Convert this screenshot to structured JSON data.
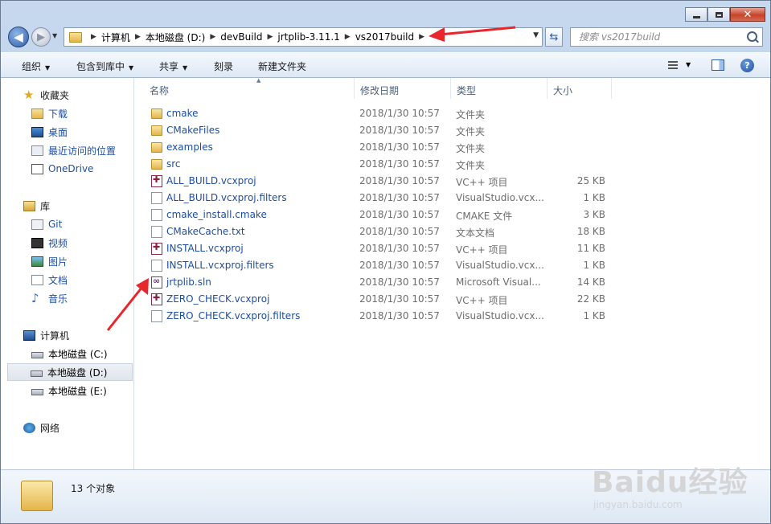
{
  "window": {
    "caption": {
      "minimize": "─",
      "maximize": "□",
      "close": "✕"
    }
  },
  "nav": {
    "breadcrumb": [
      "计算机",
      "本地磁盘 (D:)",
      "devBuild",
      "jrtplib-3.11.1",
      "vs2017build"
    ],
    "search_placeholder": "搜索 vs2017build"
  },
  "toolbar": {
    "organize": "组织",
    "include_in_library": "包含到库中",
    "share": "共享",
    "burn": "刻录",
    "new_folder": "新建文件夹"
  },
  "sidebar": {
    "favorites": {
      "label": "收藏夹",
      "items": [
        "下载",
        "桌面",
        "最近访问的位置",
        "OneDrive"
      ]
    },
    "libraries": {
      "label": "库",
      "items": [
        "Git",
        "视频",
        "图片",
        "文档",
        "音乐"
      ]
    },
    "computer": {
      "label": "计算机",
      "items": [
        "本地磁盘 (C:)",
        "本地磁盘 (D:)",
        "本地磁盘 (E:)"
      ]
    },
    "network": {
      "label": "网络"
    }
  },
  "columns": {
    "name": "名称",
    "date": "修改日期",
    "type": "类型",
    "size": "大小"
  },
  "files": [
    {
      "name": "cmake",
      "date": "2018/1/30 10:57",
      "type": "文件夹",
      "size": "",
      "icon": "folder"
    },
    {
      "name": "CMakeFiles",
      "date": "2018/1/30 10:57",
      "type": "文件夹",
      "size": "",
      "icon": "folder"
    },
    {
      "name": "examples",
      "date": "2018/1/30 10:57",
      "type": "文件夹",
      "size": "",
      "icon": "folder"
    },
    {
      "name": "src",
      "date": "2018/1/30 10:57",
      "type": "文件夹",
      "size": "",
      "icon": "folder"
    },
    {
      "name": "ALL_BUILD.vcxproj",
      "date": "2018/1/30 10:57",
      "type": "VC++ 项目",
      "size": "25 KB",
      "icon": "vcx"
    },
    {
      "name": "ALL_BUILD.vcxproj.filters",
      "date": "2018/1/30 10:57",
      "type": "VisualStudio.vcx...",
      "size": "1 KB",
      "icon": "doc"
    },
    {
      "name": "cmake_install.cmake",
      "date": "2018/1/30 10:57",
      "type": "CMAKE 文件",
      "size": "3 KB",
      "icon": "doc"
    },
    {
      "name": "CMakeCache.txt",
      "date": "2018/1/30 10:57",
      "type": "文本文档",
      "size": "18 KB",
      "icon": "doc"
    },
    {
      "name": "INSTALL.vcxproj",
      "date": "2018/1/30 10:57",
      "type": "VC++ 项目",
      "size": "11 KB",
      "icon": "vcx"
    },
    {
      "name": "INSTALL.vcxproj.filters",
      "date": "2018/1/30 10:57",
      "type": "VisualStudio.vcx...",
      "size": "1 KB",
      "icon": "doc"
    },
    {
      "name": "jrtplib.sln",
      "date": "2018/1/30 10:57",
      "type": "Microsoft Visual...",
      "size": "14 KB",
      "icon": "sln"
    },
    {
      "name": "ZERO_CHECK.vcxproj",
      "date": "2018/1/30 10:57",
      "type": "VC++ 项目",
      "size": "22 KB",
      "icon": "vcx"
    },
    {
      "name": "ZERO_CHECK.vcxproj.filters",
      "date": "2018/1/30 10:57",
      "type": "VisualStudio.vcx...",
      "size": "1 KB",
      "icon": "doc"
    }
  ],
  "status": {
    "count": "13 个对象"
  },
  "watermark": {
    "logo": "Baidu经验",
    "url": "jingyan.baidu.com"
  },
  "colors": {
    "link": "#1e4ea0",
    "annotation": "#e8262b"
  }
}
